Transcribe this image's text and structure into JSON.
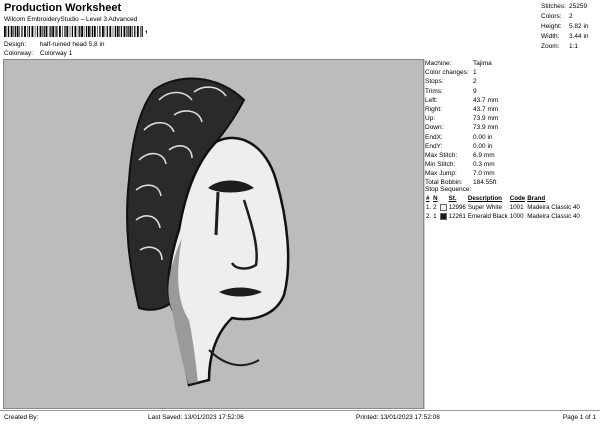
{
  "header": {
    "title": "Production Worksheet",
    "subtitle": "Wilcom EmbroideryStudio – Level 3 Advanced",
    "barcode_suffix": ",",
    "design_label": "Design:",
    "design_value": "half-ruined head 5,8 in",
    "colorway_label": "Colorway:",
    "colorway_value": "Colorway 1"
  },
  "summary": [
    {
      "label": "Stitches:",
      "value": "25259"
    },
    {
      "label": "Colors:",
      "value": "2"
    },
    {
      "label": "Height:",
      "value": "5.82 in"
    },
    {
      "label": "Width:",
      "value": "3.44 in"
    },
    {
      "label": "Zoom:",
      "value": "1:1"
    }
  ],
  "machine_info": [
    {
      "label": "Machine:",
      "value": "Tajima"
    },
    {
      "label": "Color changes:",
      "value": "1"
    },
    {
      "label": "Stops:",
      "value": "2"
    },
    {
      "label": "Trims:",
      "value": "9"
    },
    {
      "label": "Left:",
      "value": "43.7 mm"
    },
    {
      "label": "Right:",
      "value": "43.7 mm"
    },
    {
      "label": "Up:",
      "value": "73.9 mm"
    },
    {
      "label": "Down:",
      "value": "73.9 mm"
    },
    {
      "label": "EndX:",
      "value": "0.00 in"
    },
    {
      "label": "EndY:",
      "value": "0.00 in"
    },
    {
      "label": "Max Stitch:",
      "value": "6.9 mm"
    },
    {
      "label": "Min Stitch:",
      "value": "0.3 mm"
    },
    {
      "label": "Max Jump:",
      "value": "7.0 mm"
    },
    {
      "label": "Total Bobbin:",
      "value": "184.55ft"
    }
  ],
  "stop_sequence": {
    "title": "Stop Sequence:",
    "columns": [
      "#",
      "N",
      "St.",
      "Description",
      "Code",
      "Brand"
    ],
    "rows": [
      {
        "num": "1.",
        "n": "2",
        "swatch": "#f2f2f2",
        "st": "12996",
        "description": "Super White",
        "code": "1001",
        "brand": "Madeira Classic 40"
      },
      {
        "num": "2.",
        "n": "1",
        "swatch": "#1b1b1b",
        "st": "12261",
        "description": "Emerald Black",
        "code": "1000",
        "brand": "Madeira Classic 40"
      }
    ]
  },
  "footer": {
    "created_by": "Created By:",
    "last_saved": "Last Saved: 13/01/2023 17:52:06",
    "printed": "Printed: 13/01/2023 17:52:08",
    "page": "Page 1 of 1"
  },
  "colors": {
    "design_background": "#bcbcbc",
    "thread_white": "#f2f2f2",
    "thread_black": "#1b1b1b"
  }
}
